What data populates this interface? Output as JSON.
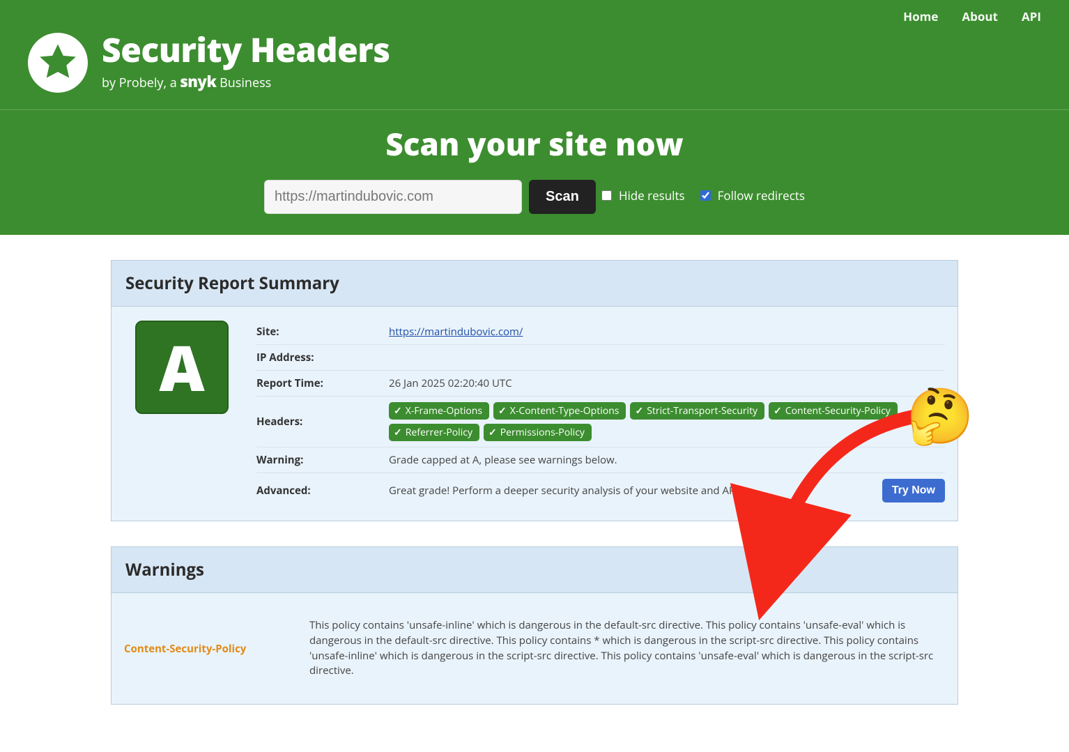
{
  "nav": {
    "home": "Home",
    "about": "About",
    "api": "API"
  },
  "brand": {
    "title": "Security Headers",
    "subline_prefix": "by Probely, a ",
    "subline_brand": "snyk",
    "subline_suffix": " Business"
  },
  "scan": {
    "heading": "Scan your site now",
    "input_value": "https://martindubovic.com",
    "button": "Scan",
    "hide_label": "Hide results",
    "follow_label": "Follow redirects",
    "hide_checked": false,
    "follow_checked": true
  },
  "summary": {
    "title": "Security Report Summary",
    "grade": "A",
    "rows": {
      "site": {
        "label": "Site:",
        "link": "https://martindubovic.com/"
      },
      "ip": {
        "label": "IP Address:",
        "value": ""
      },
      "time": {
        "label": "Report Time:",
        "value": "26 Jan 2025 02:20:40 UTC"
      },
      "headers": {
        "label": "Headers:",
        "pills": [
          "X-Frame-Options",
          "X-Content-Type-Options",
          "Strict-Transport-Security",
          "Content-Security-Policy",
          "Referrer-Policy",
          "Permissions-Policy"
        ]
      },
      "warning": {
        "label": "Warning:",
        "value": "Grade capped at A, please see warnings below."
      },
      "advanced": {
        "label": "Advanced:",
        "value": "Great grade! Perform a deeper security analysis of your website and APIs:",
        "button": "Try Now"
      }
    }
  },
  "warnings": {
    "title": "Warnings",
    "rows": [
      {
        "name": "Content-Security-Policy",
        "text": "This policy contains 'unsafe-inline' which is dangerous in the default-src directive. This policy contains 'unsafe-eval' which is dangerous in the default-src directive. This policy contains * which is dangerous in the script-src directive. This policy contains 'unsafe-inline' which is dangerous in the script-src directive. This policy contains 'unsafe-eval' which is dangerous in the script-src directive."
      }
    ]
  },
  "annotation": {
    "emoji": "🤔"
  }
}
